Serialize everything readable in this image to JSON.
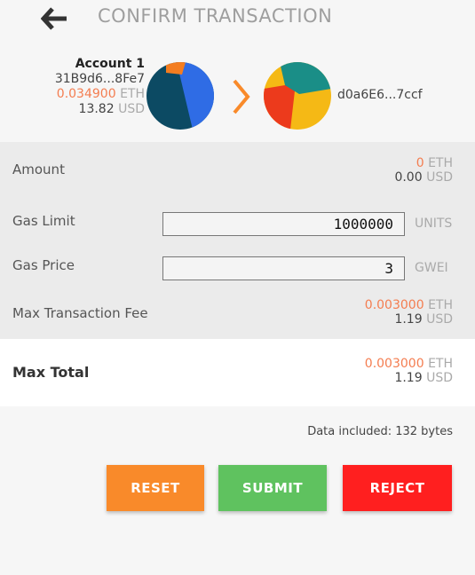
{
  "header": {
    "title": "CONFIRM TRANSACTION",
    "back_icon": "back-arrow-icon"
  },
  "from": {
    "name": "Account 1",
    "address": "31B9d6...8Fe7",
    "balance_eth": "0.034900",
    "eth_unit": "ETH",
    "balance_usd": "13.82",
    "usd_unit": "USD",
    "identicon_colors": [
      "#0c4a63",
      "#2f6ce5",
      "#f47d20"
    ]
  },
  "to": {
    "address": "d0a6E6...7ccf",
    "identicon_colors": [
      "#f5b915",
      "#ec3a1c",
      "#1a8e87"
    ]
  },
  "details": {
    "amount_label": "Amount",
    "amount_eth": "0",
    "amount_eth_unit": "ETH",
    "amount_usd": "0.00",
    "amount_usd_unit": "USD",
    "gas_limit_label": "Gas Limit",
    "gas_limit_value": "1000000",
    "gas_limit_unit": "UNITS",
    "gas_price_label": "Gas Price",
    "gas_price_value": "3",
    "gas_price_unit": "GWEI",
    "max_fee_label": "Max Transaction Fee",
    "max_fee_eth": "0.003000",
    "max_fee_eth_unit": "ETH",
    "max_fee_usd": "1.19",
    "max_fee_usd_unit": "USD"
  },
  "total": {
    "label": "Max Total",
    "eth": "0.003000",
    "eth_unit": "ETH",
    "usd": "1.19",
    "usd_unit": "USD"
  },
  "data_note": "Data included: 132 bytes",
  "buttons": {
    "reset": "RESET",
    "submit": "SUBMIT",
    "reject": "REJECT"
  },
  "colors": {
    "accent_orange": "#f47d50",
    "reset": "#f98a2a",
    "submit": "#5fc25f",
    "reject": "#ff1f1f"
  }
}
